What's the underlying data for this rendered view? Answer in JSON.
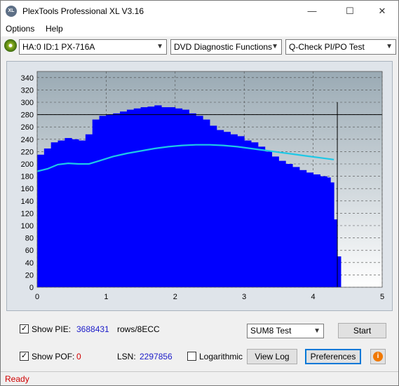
{
  "window": {
    "title": "PlexTools Professional XL V3.16",
    "icon_text": "XL",
    "minimize": "—",
    "maximize": "☐",
    "close": "✕"
  },
  "menu": {
    "items": [
      {
        "label": "Options"
      },
      {
        "label": "Help"
      }
    ]
  },
  "toolbar": {
    "drive": "HA:0 ID:1  PX-716A",
    "function": "DVD Diagnostic Functions",
    "test": "Q-Check PI/PO Test"
  },
  "chart_data": {
    "type": "bar",
    "title": "",
    "xlabel": "",
    "ylabel": "",
    "xlim": [
      0,
      5
    ],
    "ylim": [
      0,
      350
    ],
    "x_ticks": [
      "0",
      "1",
      "2",
      "3",
      "4",
      "5"
    ],
    "y_ticks": [
      "0",
      "20",
      "40",
      "60",
      "80",
      "100",
      "120",
      "140",
      "160",
      "180",
      "200",
      "220",
      "240",
      "260",
      "280",
      "300",
      "320",
      "340"
    ],
    "threshold": 280,
    "end_marker_x": 4.35,
    "grid": true,
    "series": [
      {
        "kind": "bars",
        "color": "#0000ff",
        "x": [
          0.0,
          0.1,
          0.2,
          0.3,
          0.4,
          0.5,
          0.6,
          0.7,
          0.8,
          0.9,
          1.0,
          1.1,
          1.2,
          1.3,
          1.4,
          1.5,
          1.6,
          1.7,
          1.8,
          1.9,
          2.0,
          2.1,
          2.2,
          2.3,
          2.4,
          2.5,
          2.6,
          2.7,
          2.8,
          2.9,
          3.0,
          3.1,
          3.2,
          3.3,
          3.4,
          3.5,
          3.6,
          3.7,
          3.8,
          3.9,
          4.0,
          4.1,
          4.2,
          4.25,
          4.3,
          4.35
        ],
        "values": [
          215,
          225,
          235,
          238,
          242,
          240,
          238,
          248,
          272,
          278,
          280,
          282,
          285,
          288,
          290,
          292,
          293,
          295,
          292,
          292,
          290,
          288,
          282,
          278,
          272,
          262,
          255,
          252,
          248,
          245,
          238,
          235,
          228,
          220,
          212,
          205,
          200,
          195,
          190,
          186,
          183,
          180,
          178,
          170,
          110,
          50
        ]
      },
      {
        "kind": "line",
        "color": "#1ec8e6",
        "x": [
          0.0,
          0.15,
          0.3,
          0.45,
          0.6,
          0.75,
          0.9,
          1.1,
          1.3,
          1.5,
          1.7,
          1.9,
          2.1,
          2.3,
          2.5,
          2.7,
          2.9,
          3.1,
          3.3,
          3.5,
          3.7,
          3.9,
          4.1,
          4.3
        ],
        "values": [
          188,
          192,
          199,
          201,
          200,
          200,
          205,
          212,
          217,
          221,
          225,
          228,
          230,
          231,
          231,
          230,
          228,
          225,
          222,
          219,
          216,
          213,
          210,
          207
        ]
      }
    ]
  },
  "bottom": {
    "show_pie_label": "Show PIE:",
    "pie_value": "3688431",
    "pie_unit": "rows/8ECC",
    "show_pof_label": "Show POF:",
    "pof_value": "0",
    "lsn_label": "LSN:",
    "lsn_value": "2297856",
    "log_label": "Logarithmic",
    "sum_select": "SUM8 Test",
    "start_button": "Start",
    "viewlog_button": "View Log",
    "pref_button": "Preferences",
    "info_icon": "i",
    "check_mark": "✓"
  },
  "status": {
    "text": "Ready"
  }
}
